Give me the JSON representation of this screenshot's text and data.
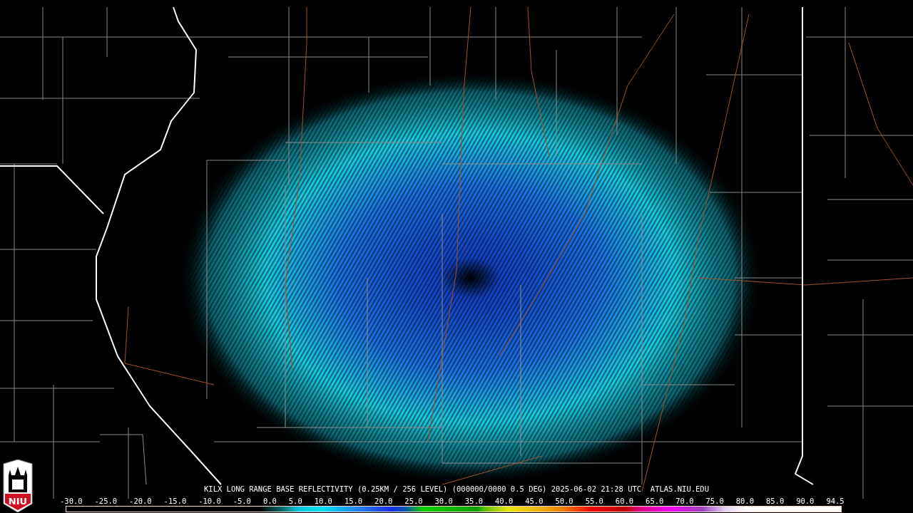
{
  "logo": {
    "text": "NIU"
  },
  "caption": "KILX LONG RANGE BASE REFLECTIVITY (0.25KM / 256 LEVEL) (000000/0000 0.5 DEG) 2025-06-02 21:28 UTC  ATLAS.NIU.EDU",
  "colorbar": {
    "labels": [
      "-30.0",
      "-25.0",
      "-20.0",
      "-15.0",
      "-10.0",
      "-5.0",
      "0.0",
      "5.0",
      "10.0",
      "15.0",
      "20.0",
      "25.0",
      "30.0",
      "35.0",
      "40.0",
      "45.0",
      "50.0",
      "55.0",
      "60.0",
      "65.0",
      "70.0",
      "75.0",
      "80.0",
      "85.0",
      "90.0",
      "94.5"
    ]
  }
}
